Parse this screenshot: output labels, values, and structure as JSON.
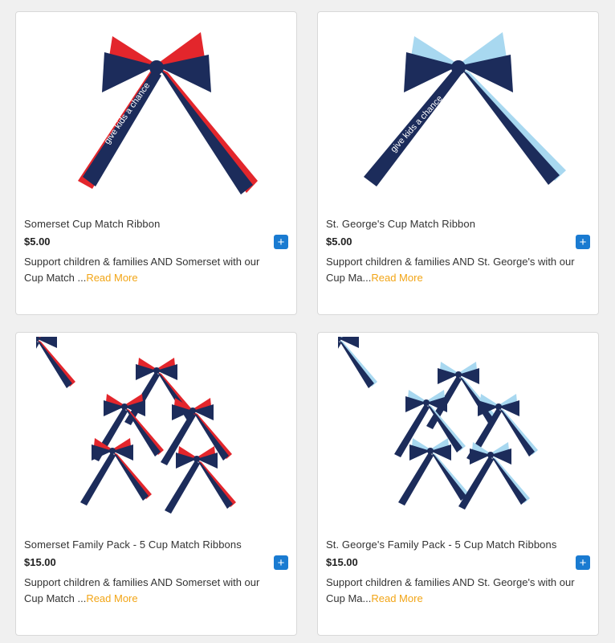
{
  "colors": {
    "accent_blue": "#1a7bd1",
    "read_more": "#f2a516",
    "navy": "#1c2c5b",
    "red": "#e3262c",
    "light_blue": "#a8d8f0"
  },
  "products": [
    {
      "title": "Somerset Cup Match Ribbon",
      "price": "$5.00",
      "add_label": "+",
      "desc_line1": "Support children & families AND Somerset with our",
      "desc_line2": "Cup Match ...",
      "read_more": "Read More",
      "ribbon_accent": "red"
    },
    {
      "title": "St. George's Cup Match Ribbon",
      "price": "$5.00",
      "add_label": "+",
      "desc_line1": "Support children & families AND St. George's with our",
      "desc_line2": "Cup Ma...",
      "read_more": "Read More",
      "ribbon_accent": "light_blue"
    },
    {
      "title": "Somerset Family Pack - 5 Cup Match Ribbons",
      "price": "$15.00",
      "add_label": "+",
      "desc_line1": "Support children & families AND Somerset with our",
      "desc_line2": "Cup Match ...",
      "read_more": "Read More",
      "ribbon_accent": "red"
    },
    {
      "title": "St. George's Family Pack - 5 Cup Match Ribbons",
      "price": "$15.00",
      "add_label": "+",
      "desc_line1": "Support children & families AND St. George's with our",
      "desc_line2": "Cup Ma...",
      "read_more": "Read More",
      "ribbon_accent": "light_blue"
    }
  ]
}
